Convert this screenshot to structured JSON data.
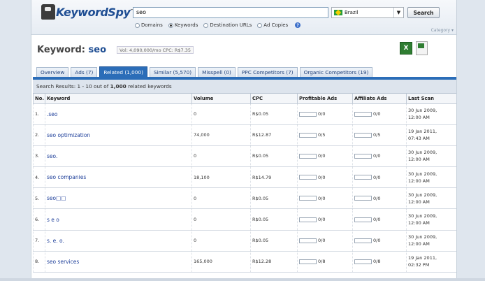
{
  "logo": {
    "text_a": "Keyword",
    "text_b": "Spy",
    "tm": "™"
  },
  "search": {
    "value": "seo",
    "country": "Brazil",
    "button": "Search"
  },
  "search_types": [
    {
      "label": "Domains",
      "selected": false
    },
    {
      "label": "Keywords",
      "selected": true
    },
    {
      "label": "Destination URLs",
      "selected": false
    },
    {
      "label": "Ad Copies",
      "selected": false
    }
  ],
  "help": "?",
  "category_link": "Category ▾",
  "keyword_heading": {
    "prefix": "Keyword:",
    "keyword": "seo",
    "stats": "Vol: 4,090,000/mo  CPC: R$7.35"
  },
  "tabs": [
    {
      "label": "Overview",
      "active": false
    },
    {
      "label": "Ads (7)",
      "active": false
    },
    {
      "label": "Related (1,000)",
      "active": true
    },
    {
      "label": "Similar (5,570)",
      "active": false
    },
    {
      "label": "Misspell (0)",
      "active": false
    },
    {
      "label": "PPC Competitors (7)",
      "active": false
    },
    {
      "label": "Organic Competitors (19)",
      "active": false
    }
  ],
  "results": {
    "prefix": "Search Results: 1 - 10 out of ",
    "total": "1,000",
    "suffix": " related keywords"
  },
  "columns": [
    "No.",
    "Keyword",
    "Volume",
    "CPC",
    "Profitable Ads",
    "Affiliate Ads",
    "Last Scan"
  ],
  "rows": [
    {
      "no": "1.",
      "keyword": ".seo",
      "volume": "0",
      "cpc": "R$0.05",
      "profitable": "0/0",
      "affiliate": "0/0",
      "scan_date": "30 Jun 2009,",
      "scan_time": "12:00 AM"
    },
    {
      "no": "2.",
      "keyword": "seo optimization",
      "volume": "74,000",
      "cpc": "R$12.87",
      "profitable": "0/5",
      "affiliate": "0/5",
      "scan_date": "19 Jan 2011,",
      "scan_time": "07:43 AM"
    },
    {
      "no": "3.",
      "keyword": "seo.",
      "volume": "0",
      "cpc": "R$0.05",
      "profitable": "0/0",
      "affiliate": "0/0",
      "scan_date": "30 Jun 2009,",
      "scan_time": "12:00 AM"
    },
    {
      "no": "4.",
      "keyword": "seo companies",
      "volume": "18,100",
      "cpc": "R$14.79",
      "profitable": "0/0",
      "affiliate": "0/0",
      "scan_date": "30 Jun 2009,",
      "scan_time": "12:00 AM"
    },
    {
      "no": "5.",
      "keyword": "seo□□",
      "volume": "0",
      "cpc": "R$0.05",
      "profitable": "0/0",
      "affiliate": "0/0",
      "scan_date": "30 Jun 2009,",
      "scan_time": "12:00 AM"
    },
    {
      "no": "6.",
      "keyword": "s e o",
      "volume": "0",
      "cpc": "R$0.05",
      "profitable": "0/0",
      "affiliate": "0/0",
      "scan_date": "30 Jun 2009,",
      "scan_time": "12:00 AM"
    },
    {
      "no": "7.",
      "keyword": "s. e. o.",
      "volume": "0",
      "cpc": "R$0.05",
      "profitable": "0/0",
      "affiliate": "0/0",
      "scan_date": "30 Jun 2009,",
      "scan_time": "12:00 AM"
    },
    {
      "no": "8.",
      "keyword": "seo services",
      "volume": "165,000",
      "cpc": "R$12.28",
      "profitable": "0/8",
      "affiliate": "0/8",
      "scan_date": "19 Jan 2011,",
      "scan_time": "02:32 PM"
    }
  ]
}
